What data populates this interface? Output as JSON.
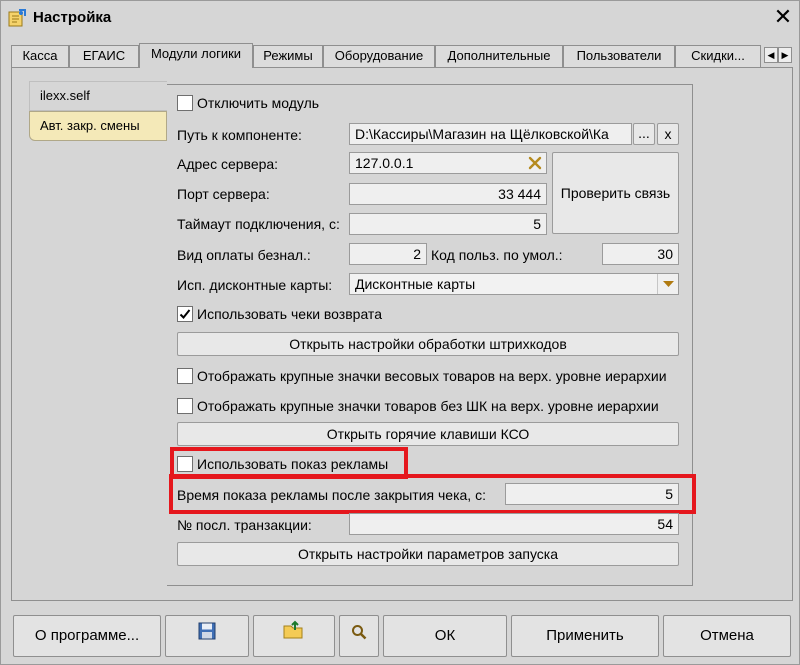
{
  "window": {
    "title": "Настройка",
    "close_glyph": "✕"
  },
  "tabs": [
    {
      "label": "Касса"
    },
    {
      "label": "ЕГАИС"
    },
    {
      "label": "Модули логики"
    },
    {
      "label": "Режимы"
    },
    {
      "label": "Оборудование"
    },
    {
      "label": "Дополнительные"
    },
    {
      "label": "Пользователи"
    },
    {
      "label": "Скидки..."
    }
  ],
  "tab_nav": {
    "prev_glyph": "◀",
    "next_glyph": "▶"
  },
  "sidebar": {
    "items": [
      {
        "label": "ilexx.self"
      },
      {
        "label": "Авт. закр. смены"
      }
    ]
  },
  "form": {
    "disable_module_label": "Отключить модуль",
    "component_path_label": "Путь к компоненте:",
    "component_path_value": "D:\\Кассиры\\Магазин на Щёлковской\\Ка",
    "browse_label": "...",
    "clear_label": "x",
    "server_address_label": "Адрес сервера:",
    "server_address_value": "127.0.0.1",
    "check_connection_label": "Проверить связь",
    "server_port_label": "Порт сервера:",
    "server_port_value": "33 444",
    "timeout_label": "Таймаут подключения, с:",
    "timeout_value": "5",
    "payment_type_label": "Вид оплаты безнал.:",
    "payment_type_value": "2",
    "user_code_label": "Код польз. по умол.:",
    "user_code_value": "30",
    "discount_cards_label": "Исп. дисконтные карты:",
    "discount_cards_value": "Дисконтные карты",
    "use_return_receipts_label": "Использовать чеки возврата",
    "use_return_receipts_checked": true,
    "open_barcode_settings_label": "Открыть настройки обработки штрихкодов",
    "large_weight_icons_label": "Отображать крупные значки весовых товаров на верх. уровне иерархии",
    "large_nobarcode_icons_label": "Отображать крупные значки товаров без ШК на верх. уровне иерархии",
    "open_hotkeys_label": "Открыть горячие клавиши КСО",
    "use_ads_label": "Использовать показ рекламы",
    "ads_time_label": "Время показа рекламы после закрытия чека, с:",
    "ads_time_value": "5",
    "last_transaction_label": "№ посл. транзакции:",
    "last_transaction_value": "54",
    "open_launch_settings_label": "Открыть настройки параметров запуска"
  },
  "buttons": {
    "about_label": "О программе...",
    "save_icon": "floppy-disk-icon",
    "export_icon": "folder-export-icon",
    "search_icon": "magnifier-icon",
    "ok_label": "ОК",
    "apply_label": "Применить",
    "cancel_label": "Отмена"
  },
  "colors": {
    "highlight": "#e5171d",
    "sidebar_item_bg": "#f4e9b8",
    "window_bg": "#d6d6d6"
  }
}
